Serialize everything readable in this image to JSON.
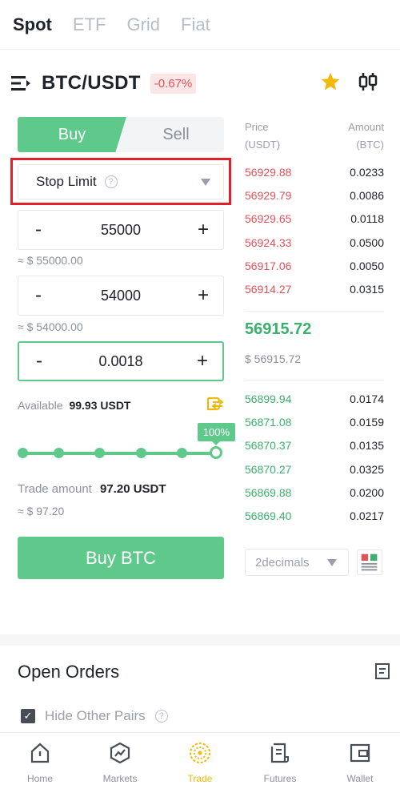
{
  "top_tabs": [
    "Spot",
    "ETF",
    "Grid",
    "Fiat"
  ],
  "pair": {
    "name": "BTC/USDT",
    "change": "-0.67%"
  },
  "trade": {
    "buy_label": "Buy",
    "sell_label": "Sell",
    "order_type": "Stop Limit",
    "stop": {
      "value": "55000",
      "approx": "≈ $ 55000.00"
    },
    "limit": {
      "value": "54000",
      "approx": "≈ $ 54000.00"
    },
    "amount": {
      "value": "0.0018"
    },
    "minus": "-",
    "plus": "+",
    "available_label": "Available",
    "available_value": "99.93 USDT",
    "slider_percent_label": "100%",
    "slider_level": 1.0,
    "trade_amount_label": "Trade amount",
    "trade_amount_value": "97.20 USDT",
    "trade_amount_approx": "≈ $ 97.20",
    "buy_button": "Buy BTC"
  },
  "order_book": {
    "price_header": "Price",
    "price_unit": "(USDT)",
    "amount_header": "Amount",
    "amount_unit": "(BTC)",
    "asks": [
      {
        "price": "56929.88",
        "qty": "0.0233"
      },
      {
        "price": "56929.79",
        "qty": "0.0086"
      },
      {
        "price": "56929.65",
        "qty": "0.0118"
      },
      {
        "price": "56924.33",
        "qty": "0.0500"
      },
      {
        "price": "56917.06",
        "qty": "0.0050"
      },
      {
        "price": "56914.27",
        "qty": "0.0315"
      }
    ],
    "last_price": "56915.72",
    "last_price_usd": "$ 56915.72",
    "bids": [
      {
        "price": "56899.94",
        "qty": "0.0174"
      },
      {
        "price": "56871.08",
        "qty": "0.0159"
      },
      {
        "price": "56870.37",
        "qty": "0.0135"
      },
      {
        "price": "56870.27",
        "qty": "0.0325"
      },
      {
        "price": "56869.88",
        "qty": "0.0200"
      },
      {
        "price": "56869.40",
        "qty": "0.0217"
      }
    ],
    "decimals": "2decimals"
  },
  "open_orders": {
    "title": "Open Orders",
    "hide_label": "Hide Other Pairs"
  },
  "nav": [
    {
      "label": "Home",
      "icon": "home-icon"
    },
    {
      "label": "Markets",
      "icon": "markets-icon"
    },
    {
      "label": "Trade",
      "icon": "trade-icon"
    },
    {
      "label": "Futures",
      "icon": "futures-icon"
    },
    {
      "label": "Wallet",
      "icon": "wallet-icon"
    }
  ],
  "colors": {
    "buy": "#5fc98c",
    "ask": "#e0525a",
    "bid": "#3bb06c",
    "accent": "#f0b90b",
    "highlight": "#e0212a"
  }
}
